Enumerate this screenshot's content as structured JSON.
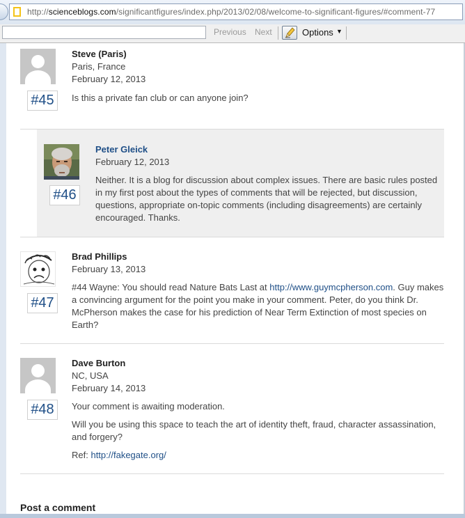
{
  "browser": {
    "url_prefix": "http://",
    "url_domain": "scienceblogs.com",
    "url_path": "/significantfigures/index.php/2013/02/08/welcome-to-significant-figures/#comment-77",
    "find_bar": {
      "input_value": "",
      "previous_label": "Previous",
      "next_label": "Next",
      "options_label": "Options"
    }
  },
  "comments": [
    {
      "author": "Steve (Paris)",
      "location": "Paris, France",
      "date": "February 12, 2013",
      "number": "#45",
      "body": "Is this a private fan club or can anyone join?"
    },
    {
      "author": "Peter Gleick",
      "date": "February 12, 2013",
      "number": "#46",
      "body": "Neither. It is a blog for discussion about complex issues. There are basic rules posted in my first post about the types of comments that will be rejected, but discussion, questions, appropriate on-topic comments (including disagreements) are certainly encouraged. Thanks."
    },
    {
      "author": "Brad Phillips",
      "date": "February 13, 2013",
      "number": "#47",
      "body_before_link": "#44 Wayne: You should read Nature Bats Last at ",
      "link": "http://www.guymcpherson.com",
      "body_after_link": ". Guy makes a convincing argument for the point you make in your comment. Peter, do you think Dr. McPherson makes the case for his prediction of Near Term Extinction of most species on Earth?"
    },
    {
      "author": "Dave Burton",
      "location": "NC, USA",
      "date": "February 14, 2013",
      "number": "#48",
      "moderation": "Your comment is awaiting moderation.",
      "body": "Will you be using this space to teach the art of identity theft, fraud, character assassination, and forgery?",
      "ref_label": "Ref: ",
      "ref_link": "http://fakegate.org/"
    }
  ],
  "post_comment_heading": "Post a comment",
  "colors": {
    "link": "#1f4f87",
    "reply_background": "#efefef",
    "comment_number": "#1f4f87"
  }
}
